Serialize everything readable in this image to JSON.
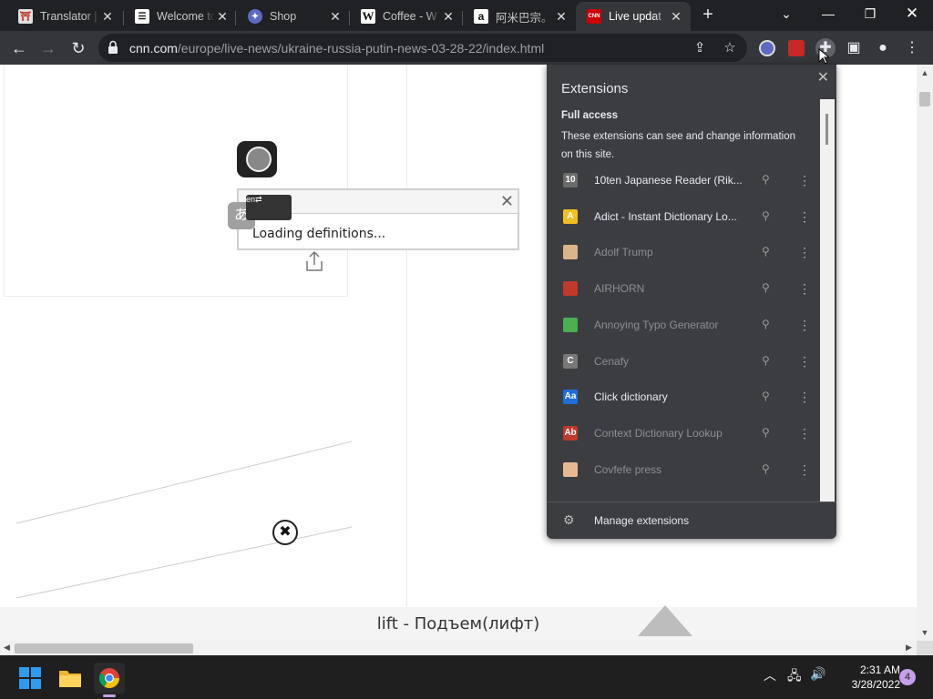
{
  "tabs": [
    {
      "title": "Translator |",
      "icon": "translator-icon"
    },
    {
      "title": "Welcome to",
      "icon": "elementor-icon"
    },
    {
      "title": "Shop",
      "icon": "shop-icon"
    },
    {
      "title": "Coffee - W",
      "icon": "wikipedia-icon"
    },
    {
      "title": "阿米巴宗。",
      "icon": "amazon-icon"
    },
    {
      "title": "Live updat",
      "icon": "cnn-icon"
    }
  ],
  "url": {
    "host": "cnn.com",
    "path": "/europe/live-news/ukraine-russia-putin-news-03-28-22/index.html"
  },
  "popup": {
    "loading": "Loading definitions..."
  },
  "bottom_caption": "lift - Подъем(лифт)",
  "extensions": {
    "title": "Extensions",
    "full_access": "Full access",
    "description": "These extensions can see and change information on this site.",
    "items": [
      {
        "name": "10ten Japanese Reader (Rik...",
        "dim": false,
        "color": "#6b6b6b",
        "glyph": "10"
      },
      {
        "name": "Adict - Instant Dictionary Lo...",
        "dim": false,
        "color": "#f0c020",
        "glyph": "A"
      },
      {
        "name": "Adolf Trump",
        "dim": true,
        "color": "#d9b58a",
        "glyph": ""
      },
      {
        "name": "AIRHORN",
        "dim": true,
        "color": "#c0392b",
        "glyph": ""
      },
      {
        "name": "Annoying Typo Generator",
        "dim": true,
        "color": "#4caf50",
        "glyph": ""
      },
      {
        "name": "Cenafy",
        "dim": true,
        "color": "#777777",
        "glyph": "C"
      },
      {
        "name": "Click dictionary",
        "dim": false,
        "color": "#1e6fd9",
        "glyph": "Aa"
      },
      {
        "name": "Context Dictionary Lookup",
        "dim": true,
        "color": "#c0392b",
        "glyph": "Ab"
      },
      {
        "name": "Covfefe press",
        "dim": true,
        "color": "#e8b890",
        "glyph": ""
      }
    ],
    "manage": "Manage extensions"
  },
  "clock": {
    "time": "2:31 AM",
    "date": "3/28/2022"
  },
  "notification_count": "4"
}
